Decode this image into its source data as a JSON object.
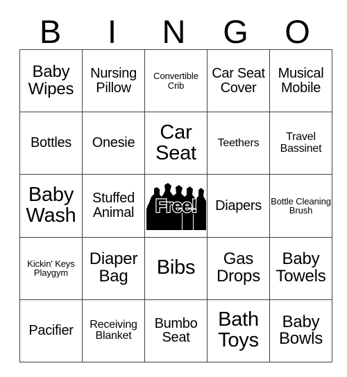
{
  "card": {
    "title_letters": [
      "B",
      "I",
      "N",
      "G",
      "O"
    ],
    "free_space_label": "Free!",
    "text_color": "#000000",
    "background_color": "#ffffff",
    "border_color": "#404040",
    "rows": 5,
    "columns": 5,
    "cells": [
      [
        {
          "text": "Baby Wipes",
          "size": "lg"
        },
        {
          "text": "Nursing Pillow",
          "size": "md"
        },
        {
          "text": "Convertible Crib",
          "size": "xs"
        },
        {
          "text": "Car Seat Cover",
          "size": "md"
        },
        {
          "text": "Musical Mobile",
          "size": "md"
        }
      ],
      [
        {
          "text": "Bottles",
          "size": "md"
        },
        {
          "text": "Onesie",
          "size": "md"
        },
        {
          "text": "Car Seat",
          "size": "xl"
        },
        {
          "text": "Teethers",
          "size": "sm"
        },
        {
          "text": "Travel Bassinet",
          "size": "sm"
        }
      ],
      [
        {
          "text": "Baby Wash",
          "size": "xl"
        },
        {
          "text": "Stuffed Animal",
          "size": "md"
        },
        {
          "text": "Free!",
          "size": "free"
        },
        {
          "text": "Diapers",
          "size": "md"
        },
        {
          "text": "Bottle Cleaning Brush",
          "size": "xs"
        }
      ],
      [
        {
          "text": "Kickin' Keys Playgym",
          "size": "xs"
        },
        {
          "text": "Diaper Bag",
          "size": "lg"
        },
        {
          "text": "Bibs",
          "size": "xl"
        },
        {
          "text": "Gas Drops",
          "size": "lg"
        },
        {
          "text": "Baby Towels",
          "size": "lg"
        }
      ],
      [
        {
          "text": "Pacifier",
          "size": "md"
        },
        {
          "text": "Receiving Blanket",
          "size": "sm"
        },
        {
          "text": "Bumbo Seat",
          "size": "md"
        },
        {
          "text": "Bath Toys",
          "size": "xl"
        },
        {
          "text": "Baby Bowls",
          "size": "lg"
        }
      ]
    ]
  }
}
